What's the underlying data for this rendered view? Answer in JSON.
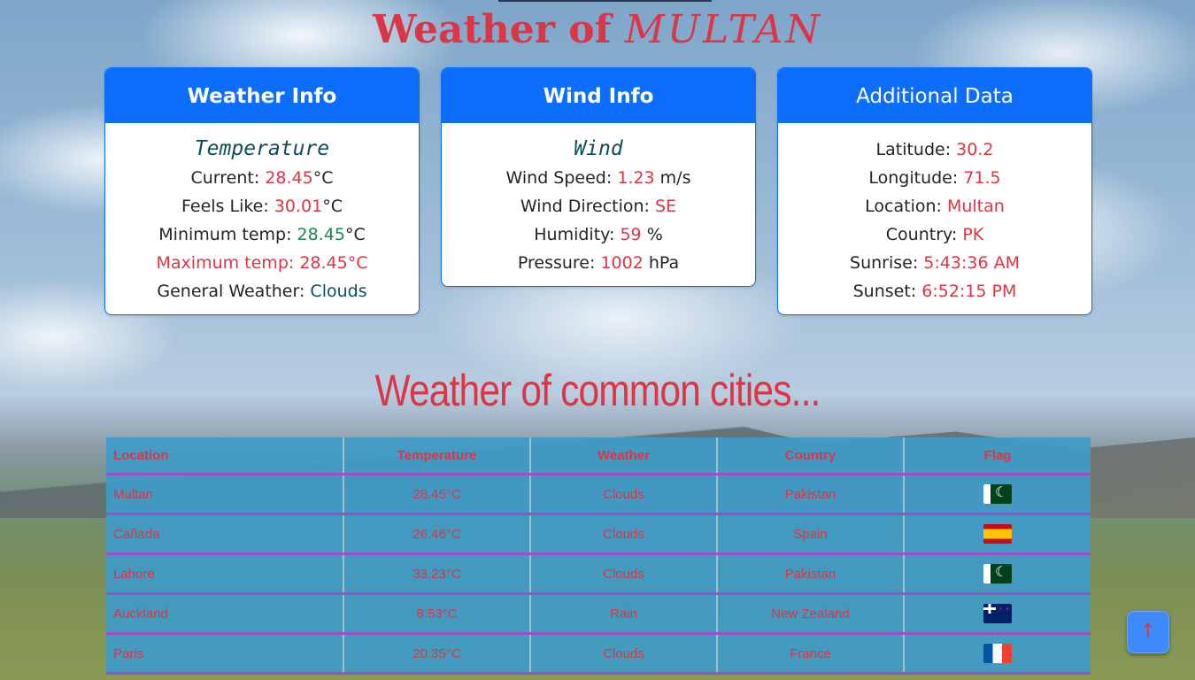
{
  "header": {
    "title_prefix": "Weather of ",
    "city": "MULTAN"
  },
  "weather_card": {
    "title": "Weather Info",
    "subtitle": "Temperature",
    "current_label": "Current: ",
    "current_value": "28.45",
    "current_unit": "°C",
    "feels_label": "Feels Like: ",
    "feels_value": "30.01",
    "feels_unit": "°C",
    "min_label": "Minimum temp: ",
    "min_value": "28.45",
    "min_unit": "°C",
    "max_text": "Maximum temp: 28.45°C",
    "general_label": "General Weather: ",
    "general_value": "Clouds"
  },
  "wind_card": {
    "title": "Wind Info",
    "subtitle": "Wind",
    "speed_label": "Wind Speed: ",
    "speed_value": "1.23",
    "speed_unit": " m/s",
    "direction_label": "Wind Direction: ",
    "direction_value": "SE",
    "humidity_label": "Humidity: ",
    "humidity_value": "59",
    "humidity_unit": " %",
    "pressure_label": "Pressure: ",
    "pressure_value": "1002",
    "pressure_unit": " hPa"
  },
  "additional_card": {
    "title": "Additional Data",
    "latitude_label": "Latitude: ",
    "latitude_value": "30.2",
    "longitude_label": "Longitude: ",
    "longitude_value": "71.5",
    "location_label": "Location: ",
    "location_value": "Multan",
    "country_label": "Country: ",
    "country_value": "PK",
    "sunrise_label": "Sunrise: ",
    "sunrise_value": "5:43:36 AM",
    "sunset_label": "Sunset: ",
    "sunset_value": "6:52:15 PM"
  },
  "cities_section": {
    "title": "Weather of common cities...",
    "headers": [
      "Location",
      "Temperature",
      "Weather",
      "Country",
      "Flag"
    ],
    "rows": [
      {
        "location": "Multan",
        "temperature": "28.45°C",
        "weather": "Clouds",
        "country": "Pakistan",
        "flag": "pk-flag-icon"
      },
      {
        "location": "Cañada",
        "temperature": "26.46°C",
        "weather": "Clouds",
        "country": "Spain",
        "flag": "es-flag-icon"
      },
      {
        "location": "Lahore",
        "temperature": "33.23°C",
        "weather": "Clouds",
        "country": "Pakistan",
        "flag": "pk-flag-icon"
      },
      {
        "location": "Auckland",
        "temperature": "8.53°C",
        "weather": "Rain",
        "country": "New Zealand",
        "flag": "nz-flag-icon"
      },
      {
        "location": "Paris",
        "temperature": "20.35°C",
        "weather": "Clouds",
        "country": "France",
        "flag": "fr-flag-icon"
      }
    ]
  },
  "scroll_top": {
    "icon": "arrow-up-icon",
    "glyph": "↑"
  },
  "colors": {
    "accent_red": "#dc3545",
    "card_blue": "#0d6efd",
    "table_blue": "#3e9bc8",
    "row_border_purple": "#9b4fc9"
  }
}
